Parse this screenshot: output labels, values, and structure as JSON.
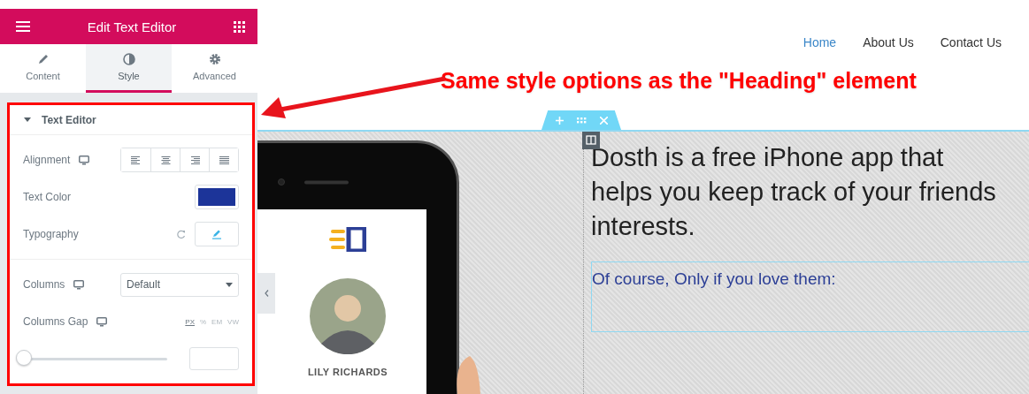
{
  "panel": {
    "title": "Edit Text Editor",
    "tabs": [
      {
        "label": "Content",
        "selected": false
      },
      {
        "label": "Style",
        "selected": true
      },
      {
        "label": "Advanced",
        "selected": false
      }
    ],
    "section": {
      "title": "Text Editor",
      "expanded": true,
      "controls": [
        {
          "kind": "alignment",
          "label": "Alignment",
          "responsive": true,
          "options": [
            {
              "selected": false
            },
            {
              "selected": false
            },
            {
              "selected": false
            },
            {
              "selected": false
            }
          ]
        },
        {
          "kind": "color",
          "label": "Text Color",
          "color": "#1c3499"
        },
        {
          "kind": "typography",
          "label": "Typography"
        },
        {
          "kind": "divider"
        },
        {
          "kind": "select",
          "label": "Columns",
          "responsive": true,
          "value": "Default"
        },
        {
          "kind": "slider",
          "label": "Columns Gap",
          "responsive": true,
          "units": [
            {
              "label": "PX",
              "selected": true
            },
            {
              "label": "%",
              "selected": false
            },
            {
              "label": "EM",
              "selected": false
            },
            {
              "label": "VW",
              "selected": false
            }
          ],
          "level": 0
        }
      ]
    }
  },
  "site": {
    "nav": [
      {
        "label": "Home",
        "selected": true
      },
      {
        "label": "About Us",
        "selected": false
      },
      {
        "label": "Contact Us",
        "selected": false
      }
    ],
    "annotation": "Same style options as the \"Heading\" element",
    "phone": {
      "name": "LILY RICHARDS"
    },
    "heading": "Dosth is a free iPhone app that helps you keep track of your friends interests.",
    "text": "Of course, Only if you love them:"
  }
}
